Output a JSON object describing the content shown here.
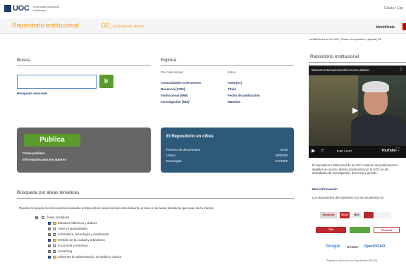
{
  "header": {
    "logo": "UOC",
    "logo_sub": "Universitat Oberta de Catalunya",
    "languages": "Català / Esp",
    "site_title": "Repositorio institucional",
    "o2_label": "O2,",
    "o2_sub": "la Oberta en abierto",
    "identify": "Identifícate"
  },
  "toplinks": "La Biblioteca de la UOC | Sobre el repositorio | Ayuda | FA",
  "busca": {
    "heading": "Busca",
    "input_value": "",
    "go_label": "Ir",
    "advanced": "Búsqueda avanzada"
  },
  "explora": {
    "heading": "Explora",
    "col1_head": "Por colecciones",
    "col2_head": "Índice",
    "col1_links": [
      "Comunidades-colecciones",
      "Docencia [3705]",
      "Institucional [669]",
      "Investigación [944]"
    ],
    "col2_links": [
      "Autor(es)",
      "Título",
      "Fecha de publicación",
      "Materias"
    ]
  },
  "publica": {
    "button": "Publica",
    "links": [
      "Cómo publicar",
      "Información para los autores"
    ]
  },
  "cifras": {
    "title": "El Repositorio en cifras",
    "rows": [
      {
        "label": "Número de documentos",
        "value": "5318"
      },
      {
        "label": "Visitas",
        "value": "2029425"
      },
      {
        "label": "Descargas",
        "value": "2471629"
      }
    ]
  },
  "areas": {
    "heading": "Búsqueda por áreas temáticas",
    "intro": "Puedes recuperar los documentos enviados al Repositorio seleccionado directamente el área o las áreas temáticas que sean de tu interés.",
    "root": "Áreas temáticas",
    "items": [
      "Estudios islámicos y árabes",
      "Artes y humanidades",
      "Informática, tecnología y multimedia",
      "Gestión de la ciudad y urbanismo",
      "Economía y empresa",
      "eLearning",
      "Sistemas de alimentación, sociedad y cultura"
    ]
  },
  "sidebar": {
    "heading": "Repositorio Institucional",
    "video_title": "Semana Internacional del Acceso abierto",
    "video_time": "0:00 / 6:37",
    "video_brand": "YouTube",
    "description": "El repositorio institucional de la UOC contiene las publicaciones digitales en acceso abierto producidas por la UOC en las actividades de investigación, docencia y gestión.",
    "more_info": "Más información",
    "docs_text": "Los documentos del repositorio O2 se encuentran en:",
    "partners": [
      "Recolecta",
      "TDX",
      "RACO",
      "Google",
      "OAIster",
      "OpenDOAR",
      "MDX",
      "Recercat"
    ],
    "footer_note": "Registry of Open Access Repositories (ROAR)"
  },
  "colors": {
    "accent_orange": "#f49a1a",
    "uoc_blue": "#1f3a6e",
    "green": "#5a9b2b",
    "cifras_blue": "#2c5a78"
  }
}
